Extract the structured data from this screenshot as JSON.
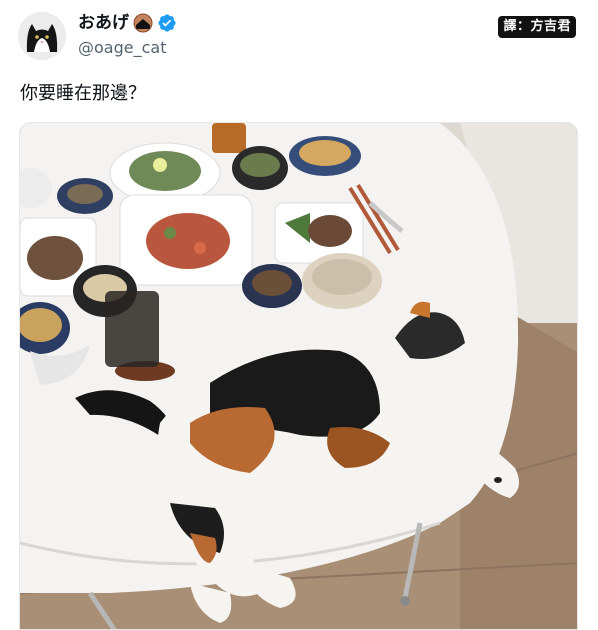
{
  "tweet": {
    "display_name": "おあげ",
    "handle": "@oage_cat",
    "text": "你要睡在那邊？",
    "translator_credit": "譯：方吉君",
    "verified": true
  },
  "icons": {
    "verified": "verified-badge-icon",
    "name_emoji": "fried-tofu-emoji-icon"
  },
  "colors": {
    "verified_blue": "#1d9bf0",
    "handle_gray": "#536471",
    "text": "#0f1419"
  }
}
